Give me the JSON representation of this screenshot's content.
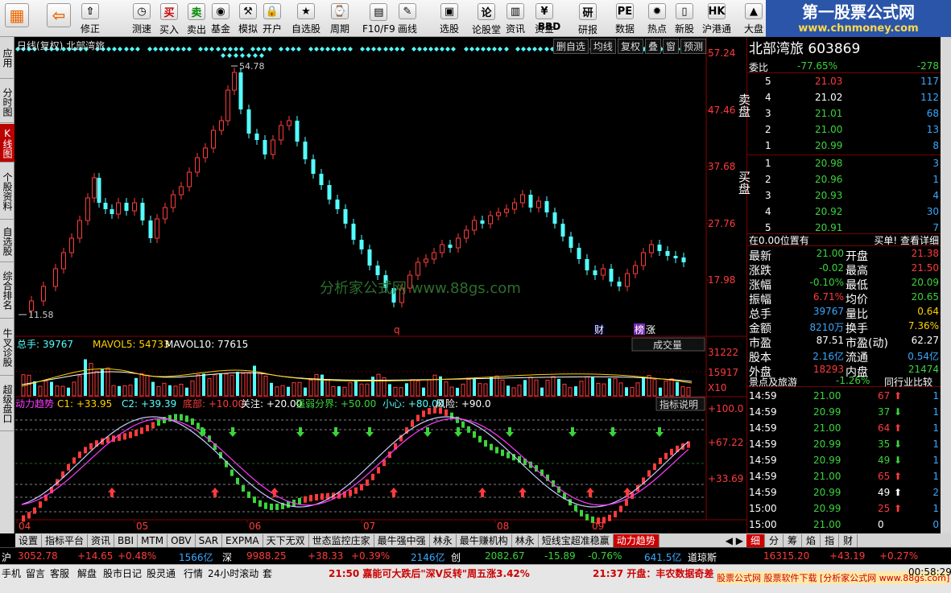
{
  "toolbar": {
    "buttons": [
      {
        "label": "",
        "icon": "windows-grid-icon"
      },
      {
        "label": "",
        "icon": "back-arrow-icon"
      },
      {
        "label": "修正",
        "icon": "arrow-up-icon"
      },
      {
        "label": "刚速",
        "icon": "refresh-icon"
      },
      {
        "label": "测速",
        "icon": "clock-icon"
      },
      {
        "label": "买入",
        "icon": "buy-icon"
      },
      {
        "label": "卖出",
        "icon": "sell-icon"
      },
      {
        "label": "基金",
        "icon": "fund-icon"
      },
      {
        "label": "模拟",
        "icon": "hammer-icon"
      },
      {
        "label": "开户",
        "icon": "lock-icon"
      },
      {
        "label": "自选股",
        "icon": "star-icon"
      },
      {
        "label": "周期",
        "icon": "period-icon"
      },
      {
        "label": "F10/F9",
        "icon": "f10-icon"
      },
      {
        "label": "画线",
        "icon": "pen-icon"
      },
      {
        "label": "选股",
        "icon": "screen-icon"
      },
      {
        "label": "论股堂",
        "icon": "forum-icon"
      },
      {
        "label": "资讯",
        "icon": "news-icon"
      },
      {
        "label": "资金",
        "icon": "fund-flow-icon"
      },
      {
        "label": "BBD",
        "icon": "bbd-icon"
      },
      {
        "label": "研报",
        "icon": "report-icon"
      },
      {
        "label": "数据",
        "icon": "data-icon"
      },
      {
        "label": "热点",
        "icon": "hot-icon"
      },
      {
        "label": "新股",
        "icon": "ipo-icon"
      },
      {
        "label": "沪港通",
        "icon": "hk-connect-icon"
      },
      {
        "label": "大盘",
        "icon": "market-icon"
      }
    ],
    "brand_title": "第一股票公式网",
    "brand_url": "www.chnmoney.com"
  },
  "vtabs": [
    "应用",
    "分时图",
    "K线图",
    "个股资料",
    "自选股",
    "综合排名",
    "牛叉诊股",
    "超级盘口"
  ],
  "chart": {
    "header": "日线(复权) 北部湾旅",
    "tools": [
      "删自选",
      "均线",
      "复权",
      "叠",
      "窗",
      "预测"
    ],
    "watermark": "分析家公式网  www.88gs.com",
    "price_axis": [
      "57.24",
      "47.46",
      "37.68",
      "27.76",
      "17.98"
    ],
    "price_high_label": "54.78",
    "price_low_label": "11.58",
    "event_q": "q",
    "event_cai": "财",
    "event_bang": "榜",
    "event_zhang": "涨",
    "volume_header": {
      "total_label": "总手: 39767",
      "ma5_label": "MAVOL5: 54733",
      "ma10_label": "MAVOL10: 77615",
      "selector": "成交量"
    },
    "volume_axis": [
      "31222",
      "15917",
      "X10"
    ],
    "indicator_header": {
      "name": "动力趋势",
      "c1": "C1: +33.95",
      "c2": "C2: +39.39",
      "bottom": "底部: +10.00",
      "focus": "关注: +20.00",
      "strong_weak": "强弱分界: +50.00",
      "careful": "小心: +80.00",
      "risk": "风险: +90.0",
      "help": "指标说明"
    },
    "indicator_axis": [
      "+100.0",
      "+67.22",
      "+33.69"
    ],
    "date_axis": [
      "04",
      "05",
      "06",
      "07",
      "08",
      "09"
    ]
  },
  "indicator_tabs": [
    "设置",
    "指标平台",
    "资讯",
    "BBI",
    "MTM",
    "OBV",
    "SAR",
    "EXPMA",
    "天下无双",
    "世态监控庄家",
    "最牛强中强",
    "林永",
    "最牛赚机构",
    "林永",
    "短线宝超准稳赢",
    "动力趋势"
  ],
  "indicator_tabs_active": "动力趋势",
  "right_panel": {
    "title": "北部湾旅 603869",
    "webi_label": "委比",
    "webi_value": "-77.65%",
    "webi_diff": "-278",
    "sell_label": "卖盘",
    "buy_label": "买盘",
    "sell": [
      {
        "level": "5",
        "price": "21.03",
        "vol": "117"
      },
      {
        "level": "4",
        "price": "21.02",
        "vol": "112"
      },
      {
        "level": "3",
        "price": "21.01",
        "vol": "68"
      },
      {
        "level": "2",
        "price": "21.00",
        "vol": "13"
      },
      {
        "level": "1",
        "price": "20.99",
        "vol": "8"
      }
    ],
    "buy": [
      {
        "level": "1",
        "price": "20.98",
        "vol": "3"
      },
      {
        "level": "2",
        "price": "20.96",
        "vol": "1"
      },
      {
        "level": "3",
        "price": "20.93",
        "vol": "4"
      },
      {
        "level": "4",
        "price": "20.92",
        "vol": "30"
      },
      {
        "level": "5",
        "price": "20.91",
        "vol": "7"
      }
    ],
    "pos_text": "在0.00位置有",
    "buy_detail": "买单! 查看详细",
    "stats": [
      {
        "l1": "最新",
        "v1": "21.00",
        "l2": "开盘",
        "v2": "21.38"
      },
      {
        "l1": "涨跌",
        "v1": "-0.02",
        "l2": "最高",
        "v2": "21.50"
      },
      {
        "l1": "涨幅",
        "v1": "-0.10%",
        "l2": "最低",
        "v2": "20.09"
      },
      {
        "l1": "振幅",
        "v1": "6.71%",
        "l2": "均价",
        "v2": "20.65"
      },
      {
        "l1": "总手",
        "v1": "39767",
        "l2": "量比",
        "v2": "0.64"
      },
      {
        "l1": "金额",
        "v1": "8210万",
        "l2": "换手",
        "v2": "7.36%"
      },
      {
        "l1": "市盈",
        "v1": "87.51",
        "l2": "市盈(动)",
        "v2": "62.27"
      },
      {
        "l1": "股本",
        "v1": "2.16亿",
        "l2": "流通",
        "v2": "0.54亿"
      },
      {
        "l1": "外盘",
        "v1": "18293",
        "l2": "内盘",
        "v2": "21474"
      }
    ],
    "sector_name": "景点及旅游",
    "sector_change": "-1.26%",
    "peer_compare": "同行业比较",
    "ticks": [
      {
        "time": "14:59",
        "price": "21.00",
        "vol": "67",
        "dir": "up",
        "n": "1"
      },
      {
        "time": "14:59",
        "price": "20.99",
        "vol": "37",
        "dir": "down",
        "n": "1"
      },
      {
        "time": "14:59",
        "price": "21.00",
        "vol": "64",
        "dir": "up",
        "n": "1"
      },
      {
        "time": "14:59",
        "price": "20.99",
        "vol": "35",
        "dir": "down",
        "n": "1"
      },
      {
        "time": "14:59",
        "price": "20.99",
        "vol": "49",
        "dir": "down",
        "n": "1"
      },
      {
        "time": "14:59",
        "price": "21.00",
        "vol": "65",
        "dir": "up",
        "n": "1"
      },
      {
        "time": "14:59",
        "price": "20.99",
        "vol": "49",
        "dir": "white",
        "n": "2"
      },
      {
        "time": "15:00",
        "price": "20.99",
        "vol": "25",
        "dir": "up",
        "n": "1"
      },
      {
        "time": "15:00",
        "price": "21.00",
        "vol": "0",
        "dir": "none",
        "n": "0"
      }
    ]
  },
  "right_tabs": [
    "细",
    "分",
    "筹",
    "焰",
    "指",
    "财"
  ],
  "index_strip": {
    "sh_label": "沪",
    "sh_value": "3052.78",
    "sh_change": "+14.65",
    "sh_pct": "+0.48%",
    "sh_amount": "1566亿",
    "sz_label": "深",
    "sz_value": "9988.25",
    "sz_change": "+38.33",
    "sz_pct": "+0.39%",
    "sz_amount": "2146亿",
    "cy_label": "创",
    "cy_value": "2082.67",
    "cy_change": "-15.89",
    "cy_pct": "-0.76%",
    "cy_amount": "641.5亿",
    "dj_label": "道琼斯",
    "dj_value": "16315.20",
    "dj_change": "+43.19",
    "dj_pct": "+0.27%"
  },
  "status_bar": {
    "items": [
      "手机",
      "留言",
      "客服",
      "解盘",
      "股市日记",
      "股灵通",
      "行情",
      "24小时滚动",
      "套"
    ],
    "news1": "21:50 嘉能可大跌后\"深V反转\"周五涨3.42%",
    "news2": "21:37 开盘：丰农数据奇差",
    "footer": "股票公式网 股票软件下载 [分析家公式网 www.88gs.com]",
    "clock": "00:58:29"
  },
  "chart_data": {
    "type": "candlestick",
    "price_range": [
      11.58,
      57.24
    ],
    "high": 54.78,
    "low": 11.58
  }
}
